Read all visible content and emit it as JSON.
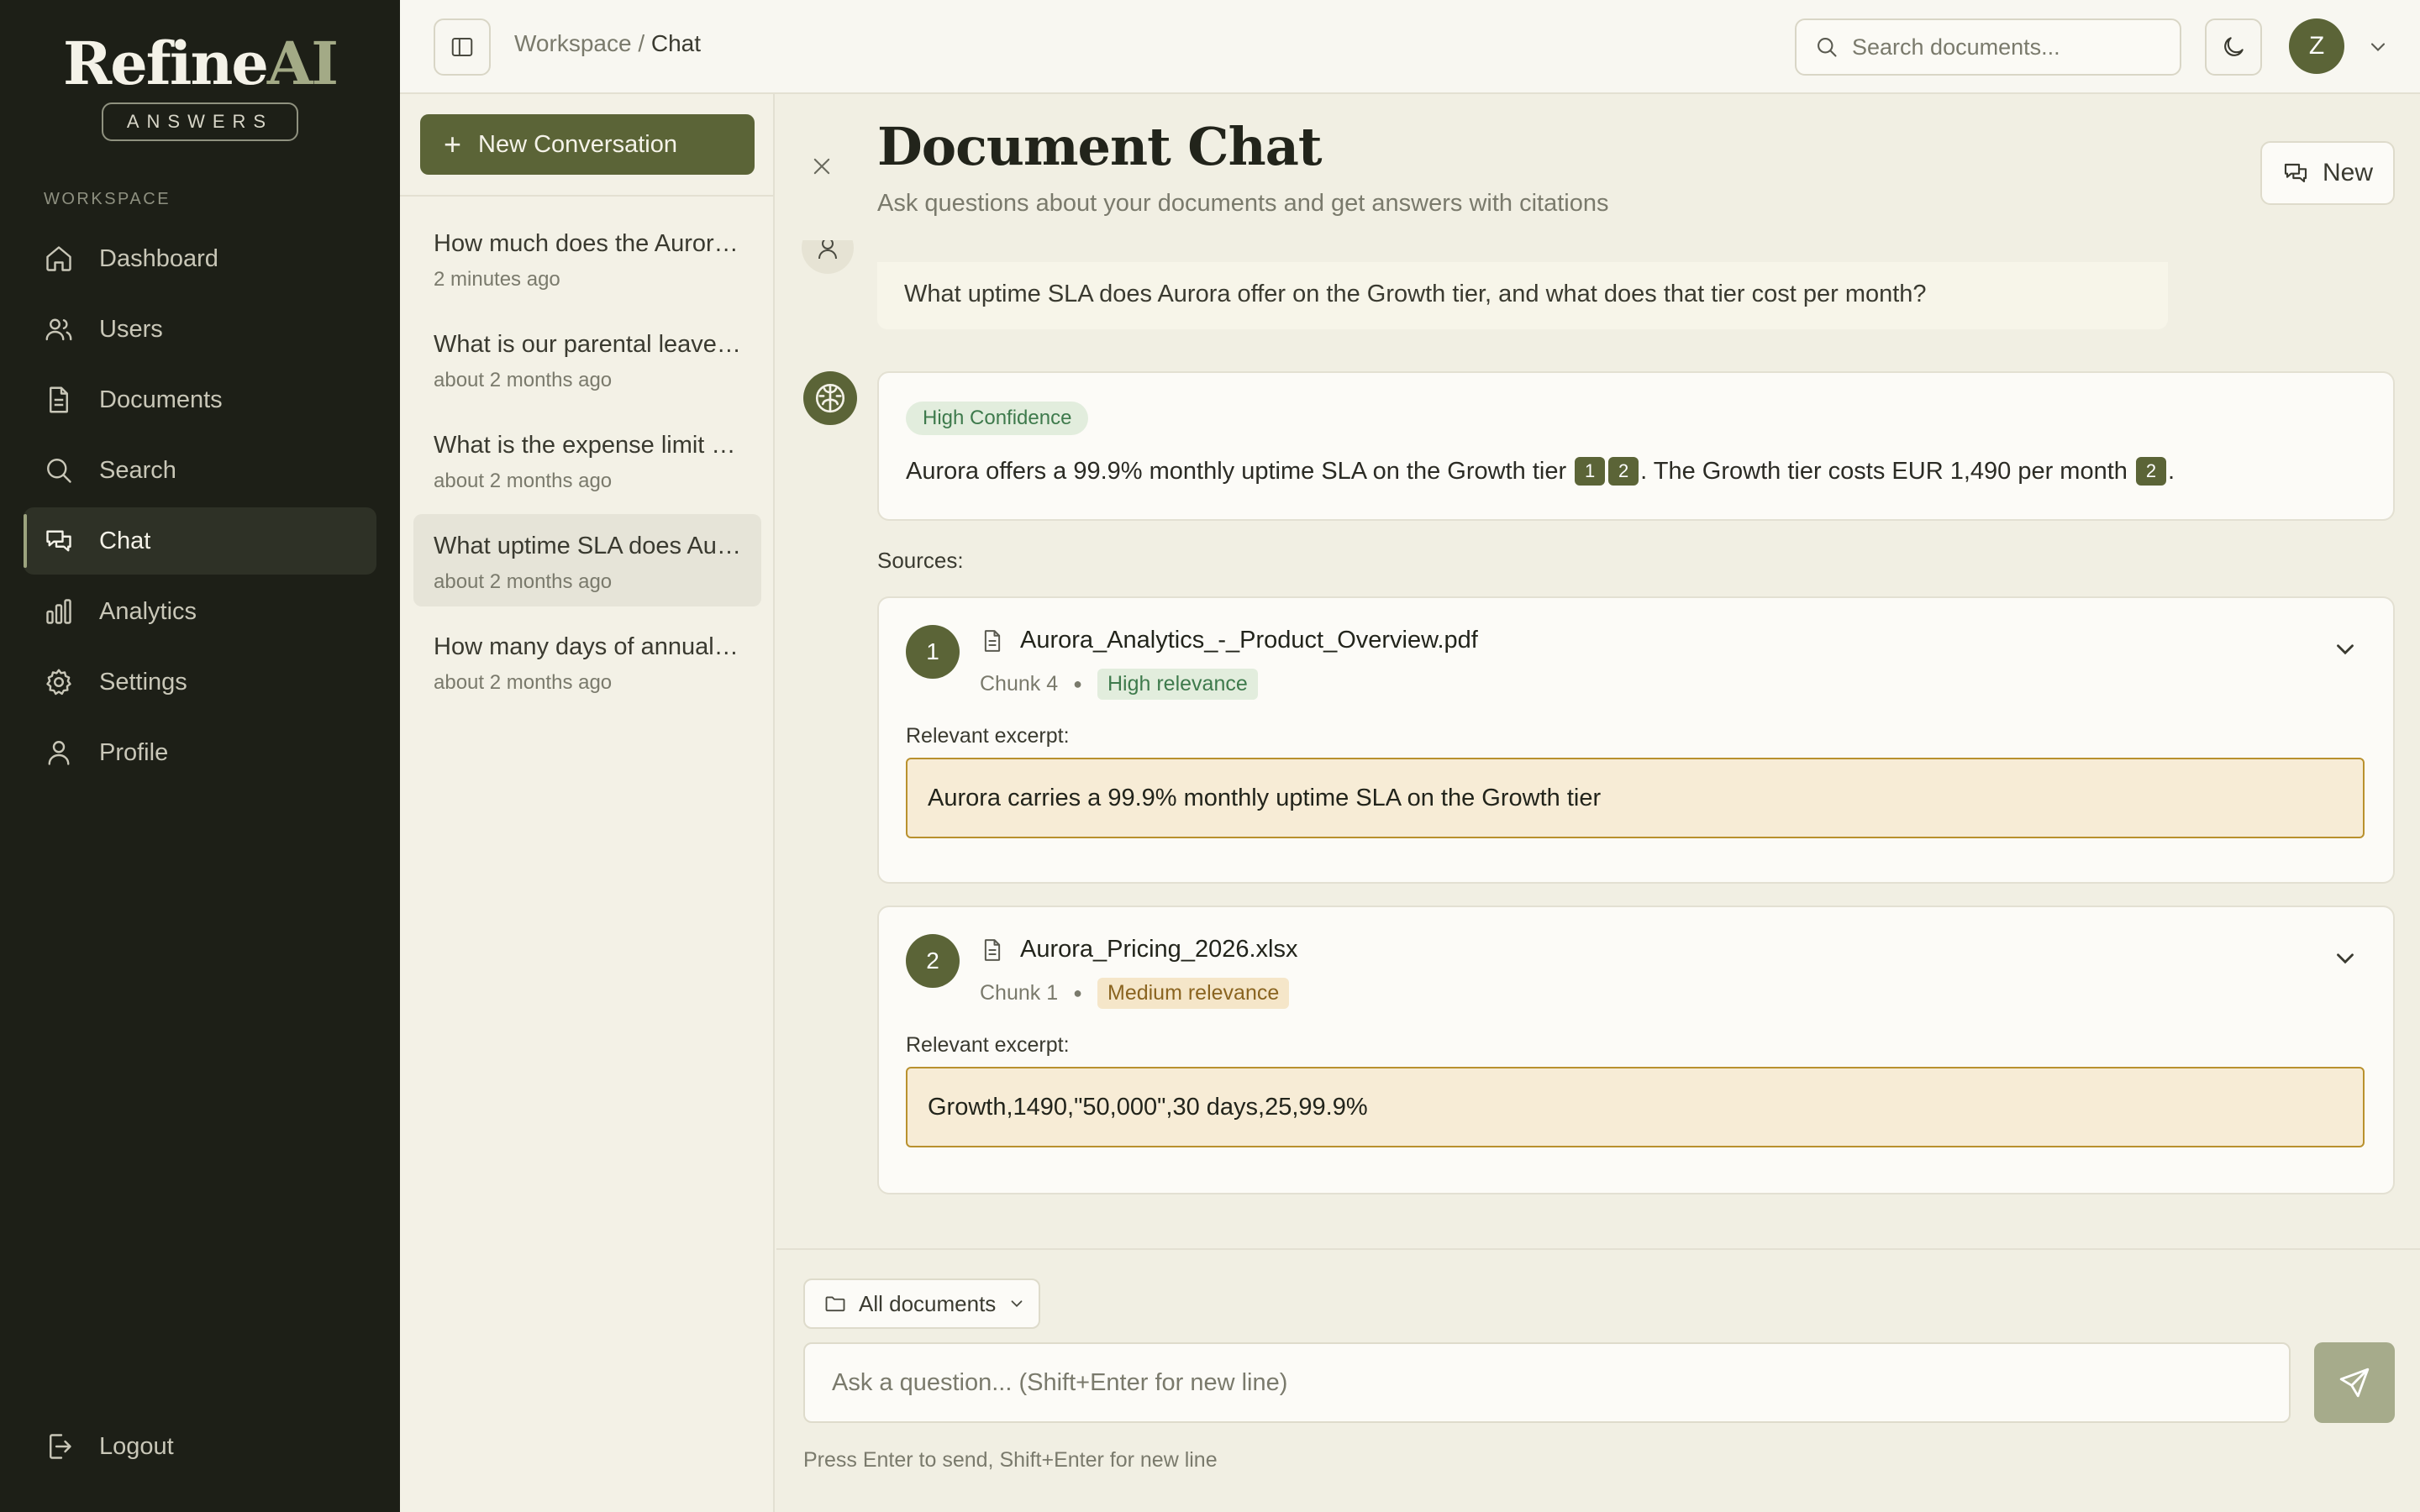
{
  "app": {
    "logo_main": "Refine",
    "logo_accent": "AI",
    "logo_sub": "ANSWERS"
  },
  "sidebar": {
    "section_label": "WORKSPACE",
    "items": [
      {
        "label": "Dashboard",
        "icon": "home-icon"
      },
      {
        "label": "Users",
        "icon": "users-icon"
      },
      {
        "label": "Documents",
        "icon": "document-icon"
      },
      {
        "label": "Search",
        "icon": "search-icon"
      },
      {
        "label": "Chat",
        "icon": "chat-icon",
        "active": true
      },
      {
        "label": "Analytics",
        "icon": "bar-chart-icon"
      },
      {
        "label": "Settings",
        "icon": "gear-icon"
      },
      {
        "label": "Profile",
        "icon": "user-icon"
      }
    ],
    "logout_label": "Logout"
  },
  "header": {
    "breadcrumb_root": "Workspace",
    "breadcrumb_sep": "/",
    "breadcrumb_current": "Chat",
    "search_placeholder": "Search documents...",
    "avatar_initial": "Z"
  },
  "conversations": {
    "new_label": "New Conversation",
    "items": [
      {
        "title": "How much does the Aurora Growth tier cost?",
        "time": "2 minutes ago"
      },
      {
        "title": "What is our parental leave policy?",
        "time": "about 2 months ago"
      },
      {
        "title": "What is the expense limit for travel?",
        "time": "about 2 months ago"
      },
      {
        "title": "What uptime SLA does Aurora offer?",
        "time": "about 2 months ago",
        "active": true
      },
      {
        "title": "How many days of annual leave do I get?",
        "time": "about 2 months ago"
      }
    ]
  },
  "main": {
    "title": "Document Chat",
    "subtitle": "Ask questions about your documents and get answers with citations",
    "new_button": "New",
    "user_question": "What uptime SLA does Aurora offer on the Growth tier, and what does that tier cost per month?",
    "confidence": "High Confidence",
    "answer_part1": "Aurora offers a 99.9% monthly uptime SLA on the Growth tier",
    "cite_1": "1",
    "cite_2": "2",
    "answer_part2": ". The Growth tier costs EUR 1,490 per month",
    "cite_3": "2",
    "answer_part3": ".",
    "sources_label": "Sources:",
    "sources": [
      {
        "num": "1",
        "file": "Aurora_Analytics_-_Product_Overview.pdf",
        "chunk": "Chunk 4",
        "relevance": "High relevance",
        "excerpt_label": "Relevant excerpt:",
        "excerpt": "Aurora carries a 99.9% monthly uptime SLA on the Growth tier"
      },
      {
        "num": "2",
        "file": "Aurora_Pricing_2026.xlsx",
        "chunk": "Chunk 1",
        "relevance": "Medium relevance",
        "excerpt_label": "Relevant excerpt:",
        "excerpt": "Growth,1490,\"50,000\",30 days,25,99.9%"
      }
    ]
  },
  "composer": {
    "scope_label": "All documents",
    "placeholder": "Ask a question... (Shift+Enter for new line)",
    "hint": "Press Enter to send, Shift+Enter for new line"
  },
  "colors": {
    "sidebar_bg": "#1d1f17",
    "accent": "#5b6437",
    "page_bg": "#f1efe3",
    "excerpt_bg": "#f7ecd6",
    "excerpt_border": "#b9912e"
  }
}
